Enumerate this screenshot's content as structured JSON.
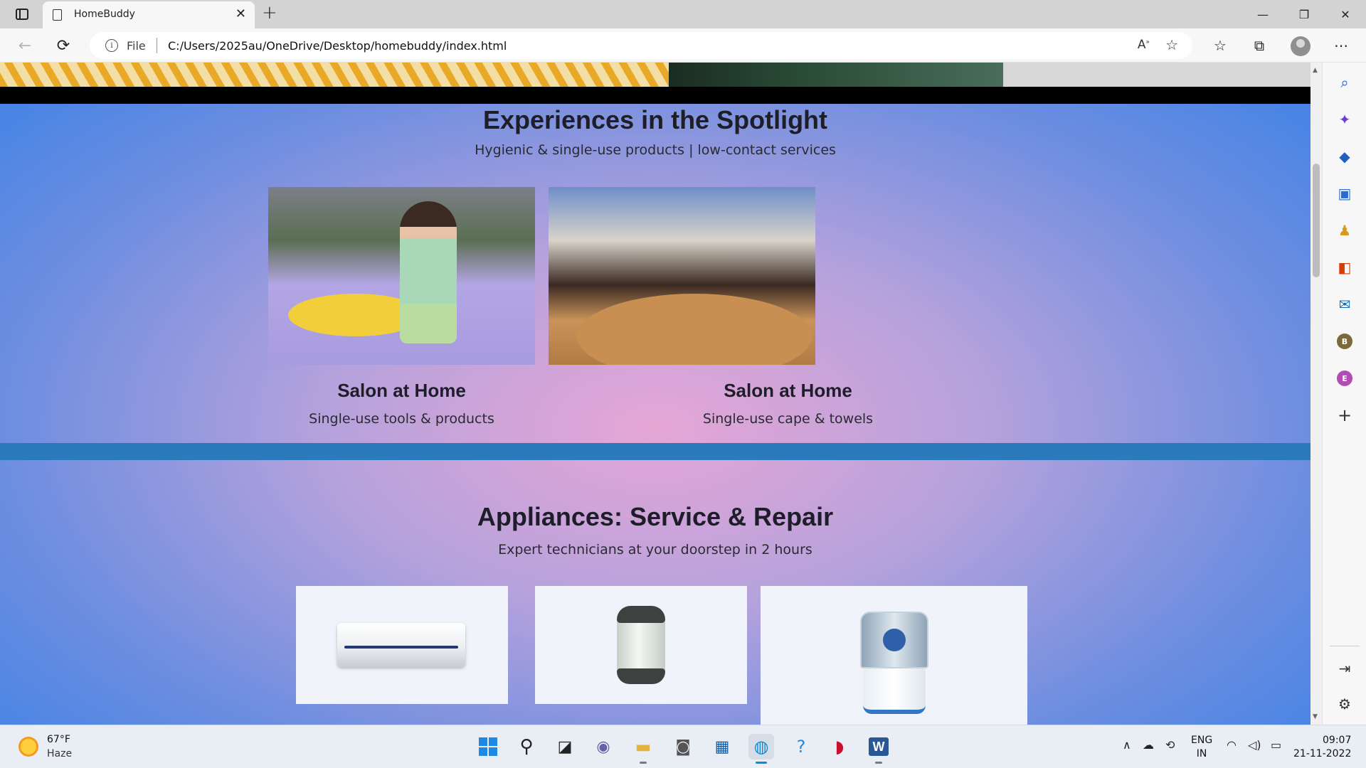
{
  "browser": {
    "tab_title": "HomeBuddy",
    "address": {
      "scheme_label": "File",
      "url": "C:/Users/2025au/OneDrive/Desktop/homebuddy/index.html"
    },
    "window_controls": [
      "minimize",
      "restore",
      "close"
    ]
  },
  "spotlight": {
    "title": "Experiences in the Spotlight",
    "subtitle": "Hygienic & single-use products | low-contact services",
    "cards": [
      {
        "title": "Salon at Home",
        "subtitle": "Single-use tools & products"
      },
      {
        "title": "Salon at Home",
        "subtitle": "Single-use cape & towels"
      }
    ]
  },
  "appliances": {
    "title": "Appliances: Service & Repair",
    "subtitle": "Expert technicians at your doorstep in 2 hours",
    "items": [
      "air-conditioner",
      "water-heater",
      "water-purifier"
    ]
  },
  "sidebar": {
    "profile_b": "B",
    "profile_e": "E"
  },
  "taskbar": {
    "temperature": "67°F",
    "weather": "Haze",
    "lang_line1": "ENG",
    "lang_line2": "IN",
    "time": "09:07",
    "date": "21-11-2022"
  },
  "colors": {
    "page_gradient_center": "#e6a6d6",
    "page_gradient_edge": "#3d82e6",
    "divider_band": "#2b7abb",
    "heading_text": "#1e1e2a"
  }
}
